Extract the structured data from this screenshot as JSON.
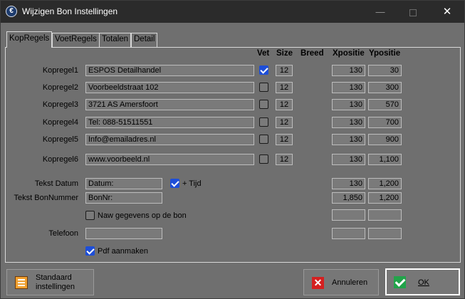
{
  "window": {
    "title": "Wijzigen Bon Instellingen",
    "icon_name": "app-logo-icon",
    "controls": {
      "minimize": "—",
      "close": "✕"
    }
  },
  "tabs": [
    {
      "label": "KopRegels",
      "active": true
    },
    {
      "label": "VoetRegels",
      "active": false
    },
    {
      "label": "Totalen",
      "active": false
    },
    {
      "label": "Detail",
      "active": false
    }
  ],
  "columns": {
    "vet": "Vet",
    "size": "Size",
    "breed": "Breed",
    "xpositie": "Xpositie",
    "ypositie": "Ypositie"
  },
  "rows": [
    {
      "label": "Kopregel1",
      "text": "ESPOS Detailhandel",
      "vet": true,
      "size": "12",
      "x": "130",
      "y": "30"
    },
    {
      "label": "Kopregel2",
      "text": "Voorbeeldstraat 102",
      "vet": false,
      "size": "12",
      "x": "130",
      "y": "300"
    },
    {
      "label": "Kopregel3",
      "text": "3721 AS  Amersfoort",
      "vet": false,
      "size": "12",
      "x": "130",
      "y": "570"
    },
    {
      "label": "Kopregel4",
      "text": "Tel: 088-51511551",
      "vet": false,
      "size": "12",
      "x": "130",
      "y": "700"
    },
    {
      "label": "Kopregel5",
      "text": "Info@emailadres.nl",
      "vet": false,
      "size": "12",
      "x": "130",
      "y": "900"
    },
    {
      "label": "Kopregel6",
      "text": "www.voorbeeld.nl",
      "vet": false,
      "size": "12",
      "x": "130",
      "y": "1,100"
    }
  ],
  "datum": {
    "label": "Tekst Datum",
    "value": "Datum:",
    "tijd_label": "+ Tijd",
    "tijd_checked": true,
    "x": "130",
    "y": "1,200"
  },
  "bonnummer": {
    "label": "Tekst BonNummer",
    "value": "BonNr:",
    "x": "1,850",
    "y": "1,200"
  },
  "naw": {
    "label": "Naw gegevens op de bon",
    "checked": false,
    "x": "",
    "y": ""
  },
  "telefoon": {
    "label": "Telefoon",
    "value": "",
    "x": "",
    "y": ""
  },
  "pdf": {
    "label": "Pdf aanmaken",
    "checked": true
  },
  "buttons": {
    "standaard_line1": "Standaard",
    "standaard_line2": "instellingen",
    "annuleren": "Annuleren",
    "ok": "OK"
  },
  "colors": {
    "titlebar": "#2b2b2b",
    "panel": "#6f6f6f",
    "checkbox_on": "#1d4ed8",
    "ok_icon": "#22a34a",
    "cancel_icon": "#d42020"
  }
}
